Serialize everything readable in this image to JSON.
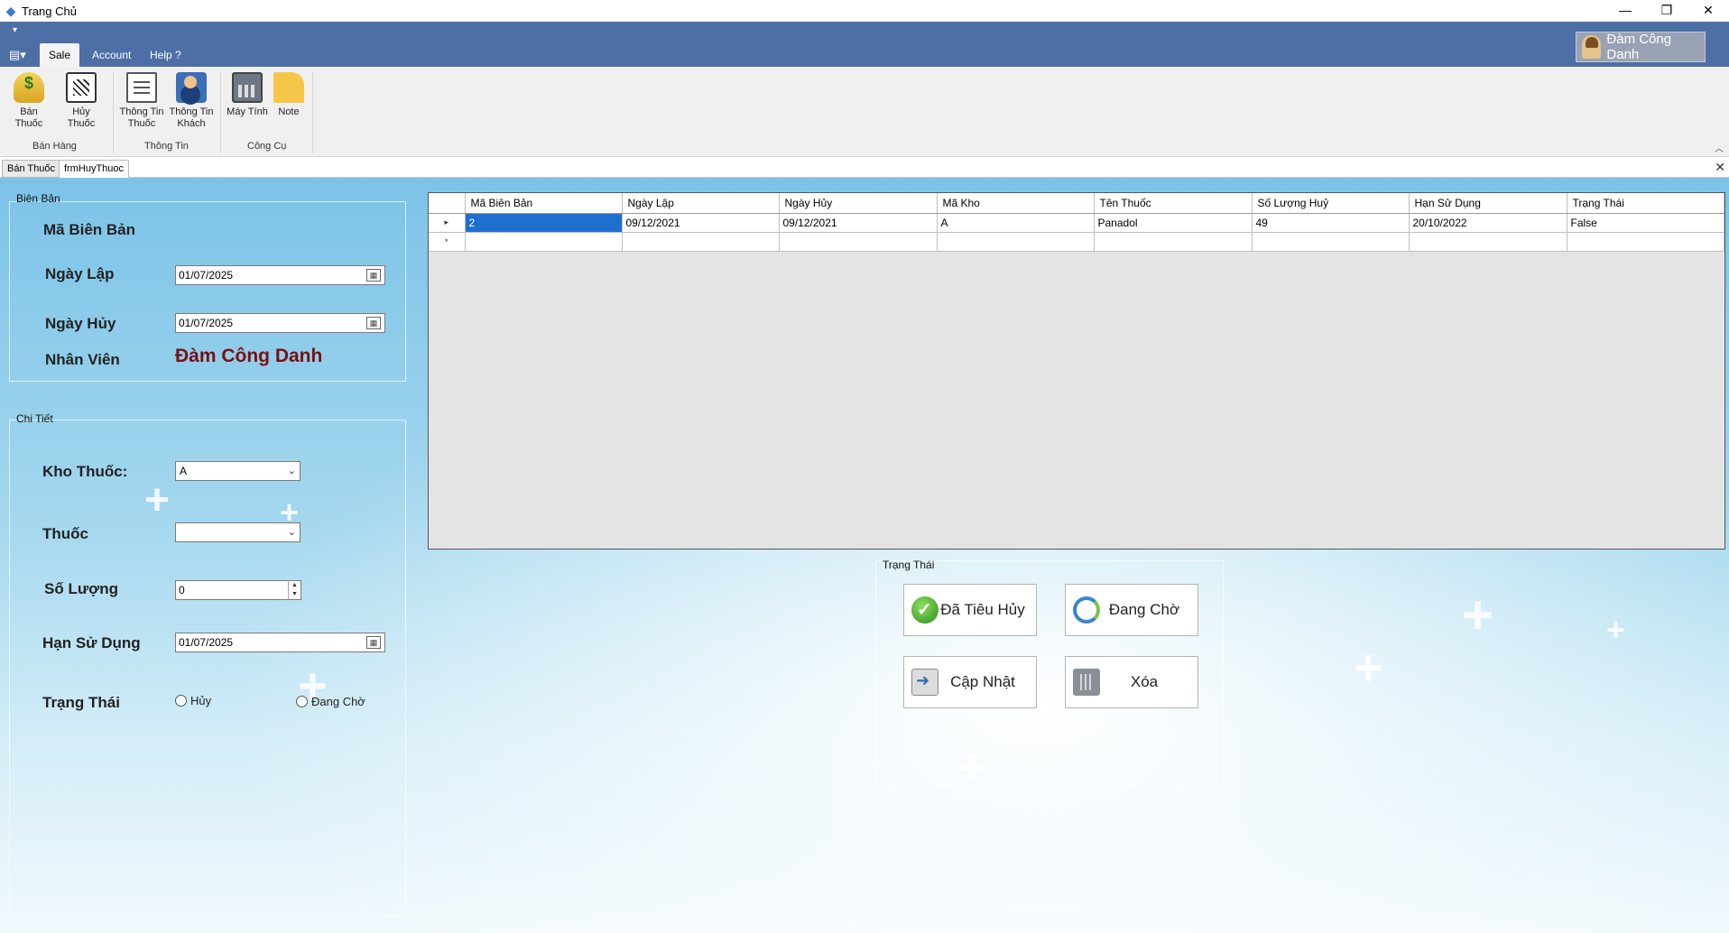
{
  "window": {
    "title": "Trang Chủ",
    "controls": [
      "—",
      "❐",
      "✕"
    ]
  },
  "ribbon": {
    "tabs": [
      {
        "label": "Sale"
      },
      {
        "label": "Account"
      },
      {
        "label": "Help ?"
      }
    ],
    "user": "Đàm Công Danh",
    "buttons": {
      "ban_thuoc": "Bán Thuốc",
      "huy_thuoc": "Hủy Thuốc",
      "thong_tin_thuoc": "Thông Tin Thuốc",
      "thong_tin_khach": "Thông Tin Khách",
      "may_tinh": "Máy Tính",
      "note": "Note"
    },
    "groups": {
      "ban_hang": "Bán Hàng",
      "thong_tin": "Thông Tin",
      "cong_cu": "Công Cụ"
    }
  },
  "doc_tabs": [
    {
      "label": "Bán Thuốc"
    },
    {
      "label": "frmHuyThuoc"
    }
  ],
  "bien_ban": {
    "title": "Biên Bản",
    "ma_label": "Mã Biên Bản",
    "ngay_lap_label": "Ngày Lập",
    "ngay_lap_value": "01/07/2025",
    "ngay_huy_label": "Ngày Hủy",
    "ngay_huy_value": "01/07/2025",
    "nhan_vien_label": "Nhân Viên",
    "nhan_vien_value": "Đàm Công Danh"
  },
  "chi_tiet": {
    "title": "Chi Tiết",
    "kho_label": "Kho Thuốc:",
    "kho_value": "A",
    "thuoc_label": "Thuốc",
    "thuoc_value": "",
    "so_luong_label": "Số Lượng",
    "so_luong_value": "0",
    "han_label": "Hạn Sử Dụng",
    "han_value": "01/07/2025",
    "trang_thai_label": "Trạng Thái",
    "radio_huy": "Hủy",
    "radio_dang_cho": "Đang Chờ"
  },
  "grid": {
    "columns": [
      "Mã Biên Bản",
      "Ngày Lập",
      "Ngày Hủy",
      "Mã Kho",
      "Tên Thuốc",
      "Số Lượng Huỷ",
      "Hạn Sử Dụng",
      "Trạng Thái"
    ],
    "rows": [
      [
        "2",
        "09/12/2021",
        "09/12/2021",
        "A",
        "Panadol",
        "49",
        "20/10/2022",
        "False"
      ]
    ]
  },
  "trang_thai_panel": {
    "title": "Trạng Thái",
    "btn_da_tieu_huy": "Đã Tiêu Hủy",
    "btn_dang_cho": "Đang Chờ",
    "btn_cap_nhat": "Cập Nhật",
    "btn_xoa": "Xóa"
  }
}
